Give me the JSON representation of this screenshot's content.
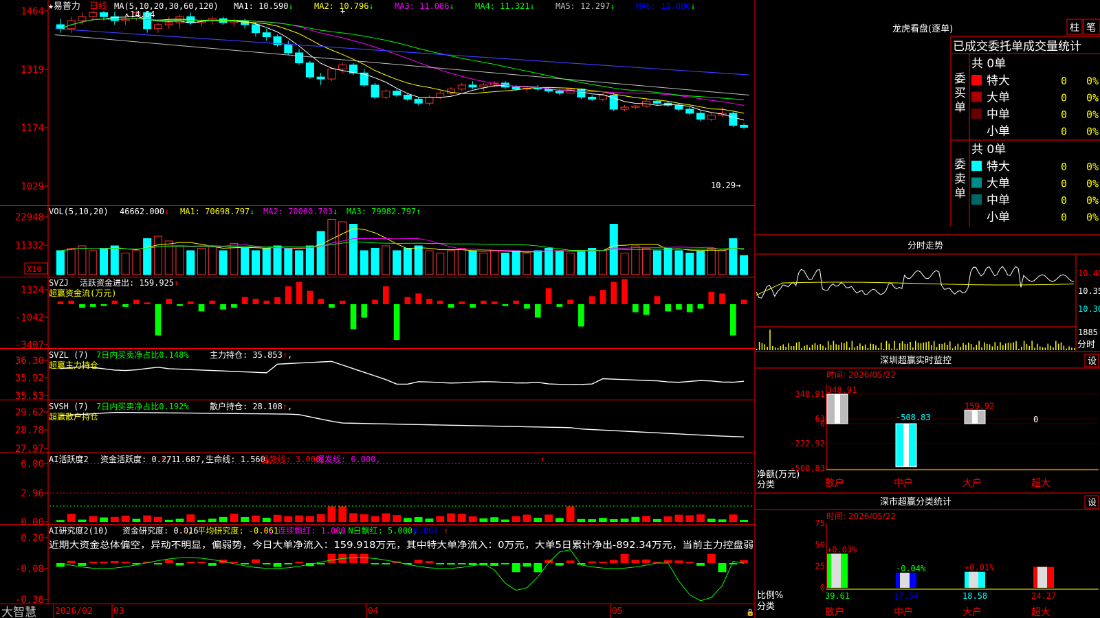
{
  "main": {
    "title": "★易普力",
    "period": "日线",
    "ma_header": "MA(5,10,20,30,60,120)",
    "ma_items": [
      {
        "label": "MA1: 10.590",
        "arrow": "↓",
        "color": "#ffffff"
      },
      {
        "label": "MA2: 10.796",
        "arrow": "↓",
        "color": "#ffff00"
      },
      {
        "label": "MA3: 11.086",
        "arrow": "↓",
        "color": "#ff00ff"
      },
      {
        "label": "MA4: 11.321",
        "arrow": "↓",
        "color": "#00ff00"
      },
      {
        "label": "MA5: 12.297",
        "arrow": "↓",
        "color": "#c0c0c0"
      },
      {
        "label": "MA6: 12.880",
        "arrow": "↓",
        "color": "#0000ff"
      }
    ],
    "high_label": "14.64",
    "low_label": "10.29",
    "y_ticks": [
      "1464",
      "1319",
      "1174",
      "1029"
    ]
  },
  "vol": {
    "header": "VOL(5,10,20)",
    "value": "46662.000",
    "arrow": "↓",
    "items": [
      {
        "label": "MA1: 70698.797",
        "arrow": "↓",
        "color": "#ffff00"
      },
      {
        "label": "MA2: 70060.703",
        "arrow": "↓",
        "color": "#ff00ff"
      },
      {
        "label": "MA3: 79982.797",
        "arrow": "↑",
        "color": "#00ff00"
      }
    ],
    "y_ticks": [
      "22948",
      "11332"
    ],
    "unit": "X10"
  },
  "svzj": {
    "header": "SVZJ",
    "line1": "活跃资金进出: 159.925",
    "arrow": "↑",
    "line2": "超赢资金流(万元)",
    "y_ticks": [
      "1324",
      "-1042",
      "-3407"
    ]
  },
  "svzl": {
    "header": "SVZL (7)",
    "desc": "7日内买卖净占比0.148%",
    "hold": "主力持仓: 35.853",
    "arrow": "↑",
    "sub": "超赢主力持仓",
    "y_ticks": [
      "36.30",
      "35.92",
      "35.53"
    ]
  },
  "svsh": {
    "header": "SVSH (7)",
    "desc": "7日内买卖净占比0.192%",
    "hold": "散户持仓: 28.108",
    "arrow": "↑",
    "sub": "超赢散户持仓",
    "y_ticks": [
      "29.62",
      "28.78",
      "27.97"
    ]
  },
  "ai1": {
    "header": "AI活跃度2",
    "items": [
      {
        "text": "资金活跃度: 0.271",
        "color": "#ffffff"
      },
      {
        "text": "↑",
        "color": "#ff0000"
      },
      {
        "text": ", 1.687,",
        "color": "#ffffff"
      },
      {
        "text": "生命线: 1.560,",
        "color": "#ffffff"
      },
      {
        "text": "强势线: 3.000,",
        "color": "#ff0000"
      },
      {
        "text": "爆发线: 6.000,",
        "color": "#ff00ff"
      }
    ],
    "arrow": "↑",
    "y_ticks": [
      "6.00",
      "2.96",
      "0.00"
    ]
  },
  "ai2": {
    "header": "AI研究度2(10)",
    "items": [
      {
        "text": "资金研究度: 0.016",
        "color": "#ffffff"
      },
      {
        "text": "↑",
        "color": "#ff0000"
      },
      {
        "text": ", 平均研究度: -0.061",
        "color": "#ffff00"
      },
      {
        "text": "↑",
        "color": "#ff0000"
      },
      {
        "text": ", 连续飘红: 1.000",
        "color": "#ff00ff"
      },
      {
        "text": "↑",
        "color": "#ff0000"
      },
      {
        "text": ", N日飘红: 5.000,",
        "color": "#00ff00"
      },
      {
        "text": " -0.061",
        "color": "#0000ff"
      },
      {
        "text": "↑",
        "color": "#ff0000"
      }
    ],
    "comment": "近期大资金总体偏空，异动不明显，偏弱势，今日大单净流入：159.918万元，其中特大单净流入：0万元，大单5日累计净出-892.34万元，当前主力控盘弱",
    "y_ticks": [
      "0.20",
      "-0.08",
      "-0.36"
    ]
  },
  "xaxis": {
    "brand": "大智慧",
    "labels": [
      "2026/02",
      "03",
      "04",
      "05"
    ]
  },
  "right": {
    "dragon_title": "龙虎看盘(逐单)",
    "tabs": [
      "柱",
      "笔"
    ],
    "subtabs": [
      "已成交",
      "委托单",
      "成交量",
      "统计"
    ],
    "buy": {
      "side_label": "委买单",
      "total": "共 0单",
      "rows": [
        {
          "name": "特大",
          "count": "0",
          "pct": "0%",
          "color": "#ff0000"
        },
        {
          "name": "大单",
          "count": "0",
          "pct": "0%",
          "color": "#aa0000"
        },
        {
          "name": "中单",
          "count": "0",
          "pct": "0%",
          "color": "#660000"
        },
        {
          "name": "小单",
          "count": "0",
          "pct": "0%",
          "color": "#000000"
        }
      ]
    },
    "sell": {
      "side_label": "委卖单",
      "total": "共 0单",
      "rows": [
        {
          "name": "特大",
          "count": "0",
          "pct": "0%",
          "color": "#00ffff"
        },
        {
          "name": "大单",
          "count": "0",
          "pct": "0%",
          "color": "#008b8b"
        },
        {
          "name": "中单",
          "count": "0",
          "pct": "0%",
          "color": "#006666"
        },
        {
          "name": "小单",
          "count": "0",
          "pct": "0%",
          "color": "#000000"
        }
      ]
    },
    "intraday": {
      "title": "分时走势",
      "y_ticks": [
        "10.40",
        "10.35",
        "10.30"
      ],
      "vol_tick": "1885",
      "vol_label": "分时"
    },
    "monitor": {
      "title": "深圳超赢实时监控",
      "set": "设",
      "time": "时间: 2026/05/22",
      "y_ticks": [
        "348.91",
        "63",
        "0",
        "-222.92",
        "-508.83"
      ],
      "ylabel1": "净额(万元)",
      "ylabel2": "分类",
      "categories": [
        "散户",
        "中户",
        "大户",
        "超大"
      ],
      "values": [
        348.91,
        -508.83,
        159.92,
        0
      ],
      "value_labels": [
        "348.91",
        "-508.83",
        "159.92",
        "0"
      ]
    },
    "stats": {
      "title": "深市超赢分类统计",
      "set": "设",
      "time": "时间: 2026/05/22",
      "y_ticks": [
        "75",
        "50",
        "25",
        "0"
      ],
      "ylabel1": "比例%",
      "ylabel2": "分类",
      "categories": [
        "散户",
        "中户",
        "大户",
        "超大"
      ],
      "values": [
        39.61,
        17.54,
        18.58,
        24.27
      ],
      "changes": [
        "+0.03%",
        "-0.04%",
        "+0.01%",
        ""
      ]
    }
  },
  "chart_data": {
    "type": "candlestick",
    "ohlc": [
      [
        14.3,
        14.45,
        14.1,
        14.2
      ],
      [
        14.2,
        14.5,
        14.1,
        14.4
      ],
      [
        14.4,
        14.6,
        14.3,
        14.5
      ],
      [
        14.5,
        14.64,
        14.4,
        14.6
      ],
      [
        14.6,
        14.64,
        14.4,
        14.5
      ],
      [
        14.5,
        14.62,
        14.3,
        14.4
      ],
      [
        14.4,
        14.55,
        14.3,
        14.45
      ],
      [
        14.45,
        14.64,
        14.4,
        14.6
      ],
      [
        14.6,
        14.64,
        14.1,
        14.2
      ],
      [
        14.2,
        14.35,
        14.1,
        14.3
      ],
      [
        14.3,
        14.5,
        14.2,
        14.35
      ],
      [
        14.35,
        14.55,
        14.2,
        14.5
      ],
      [
        14.5,
        14.6,
        14.3,
        14.35
      ],
      [
        14.35,
        14.45,
        14.25,
        14.4
      ],
      [
        14.4,
        14.5,
        14.3,
        14.45
      ],
      [
        14.45,
        14.5,
        14.3,
        14.35
      ],
      [
        14.35,
        14.45,
        14.25,
        14.4
      ],
      [
        14.4,
        14.45,
        14.2,
        14.3
      ],
      [
        14.3,
        14.35,
        14.0,
        14.1
      ],
      [
        14.1,
        14.2,
        13.9,
        14.0
      ],
      [
        14.0,
        14.05,
        13.75,
        13.8
      ],
      [
        13.8,
        13.9,
        13.55,
        13.6
      ],
      [
        13.6,
        13.7,
        13.3,
        13.35
      ],
      [
        13.35,
        13.4,
        12.95,
        13.0
      ],
      [
        13.0,
        13.1,
        12.8,
        12.95
      ],
      [
        12.95,
        13.25,
        12.9,
        13.2
      ],
      [
        13.2,
        13.35,
        13.1,
        13.3
      ],
      [
        13.3,
        13.35,
        13.05,
        13.1
      ],
      [
        13.1,
        13.2,
        12.75,
        12.8
      ],
      [
        12.8,
        12.85,
        12.45,
        12.5
      ],
      [
        12.5,
        12.7,
        12.45,
        12.65
      ],
      [
        12.65,
        12.7,
        12.5,
        12.55
      ],
      [
        12.55,
        12.6,
        12.4,
        12.45
      ],
      [
        12.45,
        12.5,
        12.3,
        12.35
      ],
      [
        12.35,
        12.55,
        12.3,
        12.5
      ],
      [
        12.5,
        12.65,
        12.45,
        12.6
      ],
      [
        12.6,
        12.75,
        12.55,
        12.7
      ],
      [
        12.7,
        12.85,
        12.65,
        12.8
      ],
      [
        12.8,
        12.9,
        12.7,
        12.75
      ],
      [
        12.75,
        12.85,
        12.65,
        12.8
      ],
      [
        12.8,
        12.9,
        12.75,
        12.85
      ],
      [
        12.85,
        12.9,
        12.7,
        12.75
      ],
      [
        12.75,
        12.8,
        12.65,
        12.7
      ],
      [
        12.7,
        12.78,
        12.62,
        12.72
      ],
      [
        12.72,
        12.8,
        12.65,
        12.7
      ],
      [
        12.7,
        12.75,
        12.6,
        12.65
      ],
      [
        12.65,
        12.7,
        12.55,
        12.6
      ],
      [
        12.6,
        12.72,
        12.58,
        12.7
      ],
      [
        12.7,
        12.72,
        12.45,
        12.5
      ],
      [
        12.5,
        12.55,
        12.4,
        12.45
      ],
      [
        12.45,
        12.6,
        12.4,
        12.55
      ],
      [
        12.55,
        12.6,
        12.15,
        12.2
      ],
      [
        12.2,
        12.3,
        12.15,
        12.25
      ],
      [
        12.25,
        12.3,
        12.2,
        12.28
      ],
      [
        12.28,
        12.45,
        12.25,
        12.4
      ],
      [
        12.4,
        12.45,
        12.3,
        12.35
      ],
      [
        12.35,
        12.4,
        12.25,
        12.3
      ],
      [
        12.3,
        12.35,
        12.15,
        12.2
      ],
      [
        12.2,
        12.25,
        12.05,
        12.1
      ],
      [
        12.1,
        12.15,
        11.9,
        11.95
      ],
      [
        11.95,
        12.1,
        11.9,
        12.05
      ],
      [
        12.05,
        12.25,
        12.0,
        12.1
      ],
      [
        12.1,
        12.15,
        11.75,
        11.8
      ],
      [
        11.8,
        11.85,
        11.7,
        11.75
      ]
    ],
    "ma5_desc": "white",
    "volumes": [
      10,
      11,
      12,
      10,
      11,
      12,
      9,
      10,
      15,
      16,
      14,
      12,
      10,
      11,
      12,
      10,
      13,
      11,
      10,
      11,
      12,
      11,
      10,
      12,
      18,
      23,
      22,
      21,
      10,
      11,
      12,
      10,
      11,
      12,
      10,
      9,
      10,
      11,
      10,
      9,
      10,
      9,
      10,
      9,
      10,
      11,
      10,
      9,
      10,
      11,
      10,
      21,
      9,
      12,
      11,
      10,
      11,
      10,
      9,
      10,
      11,
      10,
      15,
      8
    ]
  }
}
